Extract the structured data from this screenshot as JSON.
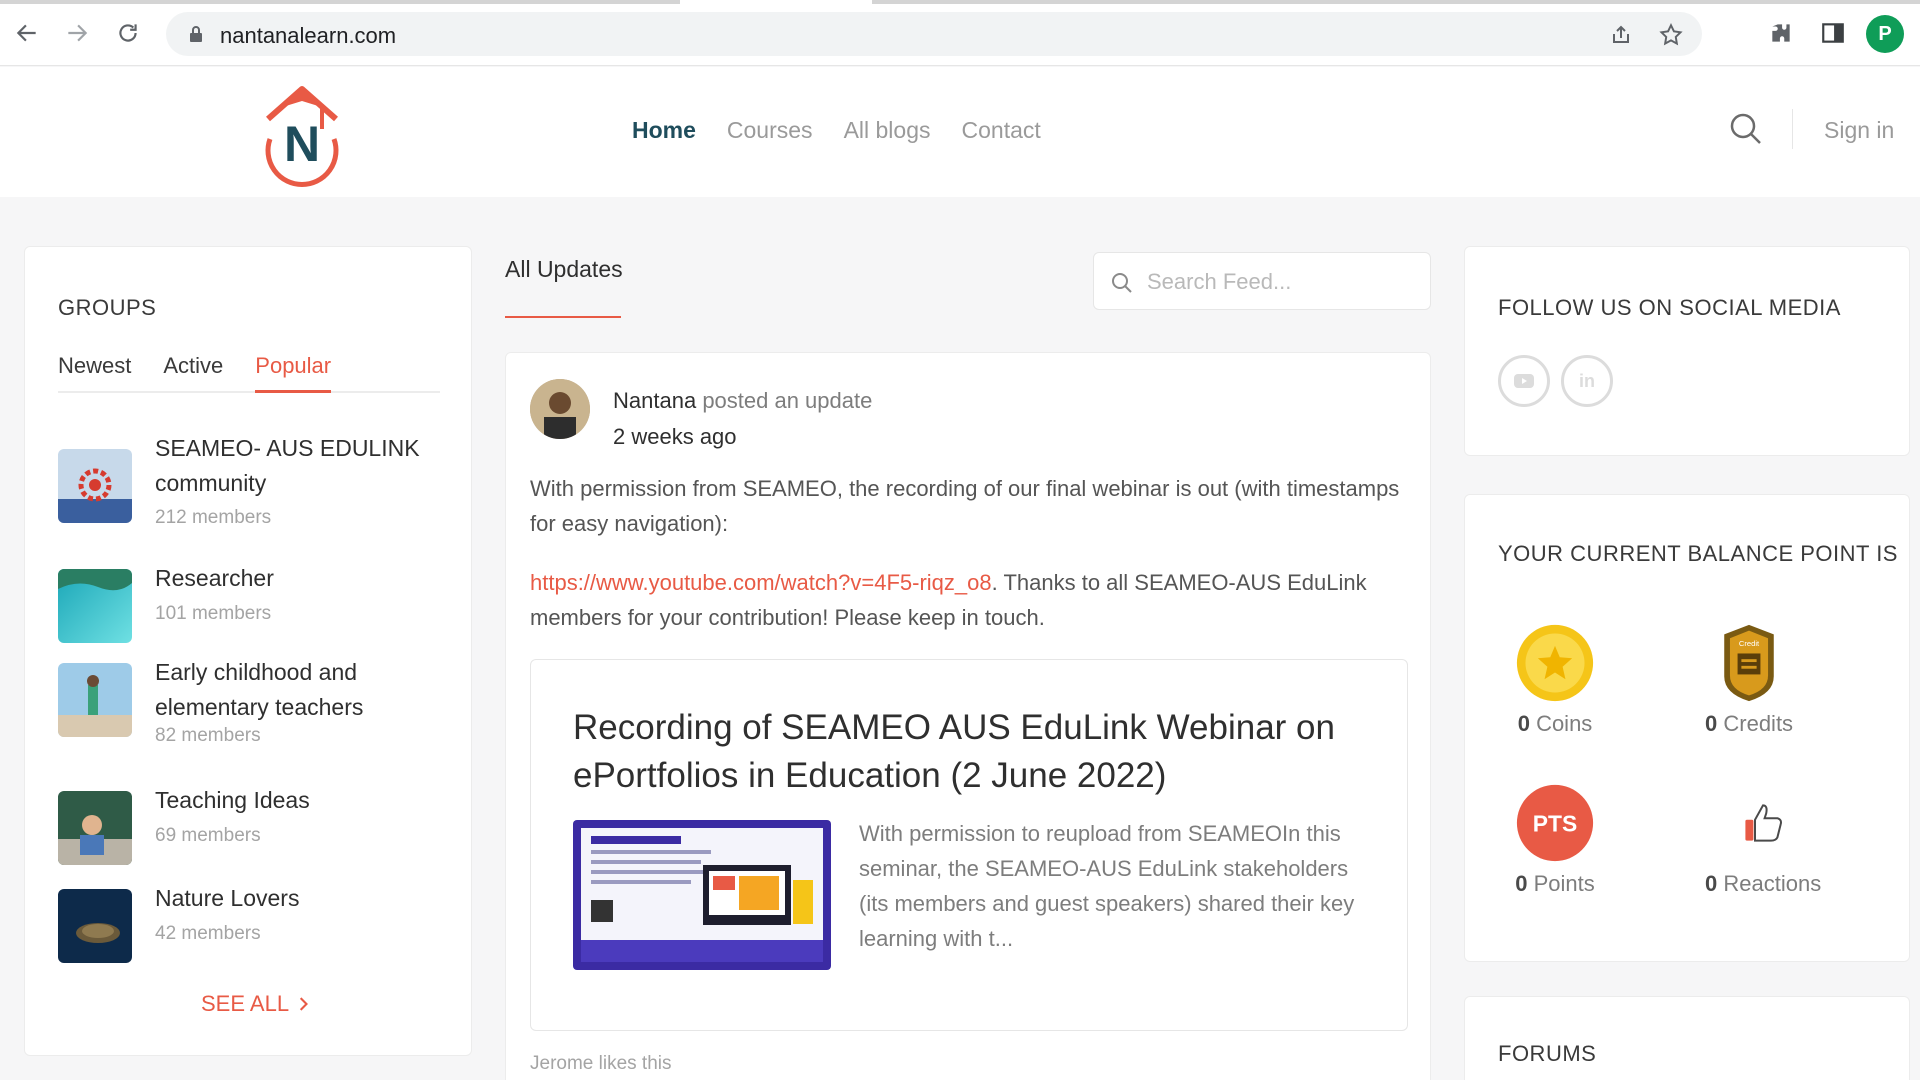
{
  "browser": {
    "url": "nantanalearn.com",
    "profile_initial": "P",
    "icons": [
      "back-arrow-icon",
      "forward-arrow-icon",
      "reload-icon",
      "lock-icon",
      "share-icon",
      "star-icon",
      "extensions-puzzle-icon",
      "side-panel-icon"
    ]
  },
  "header": {
    "logo_letter": "N",
    "nav": [
      "Home",
      "Courses",
      "All blogs",
      "Contact"
    ],
    "active_nav": "Home",
    "sign_in": "Sign in"
  },
  "groups": {
    "title": "GROUPS",
    "tabs": [
      "Newest",
      "Active",
      "Popular"
    ],
    "active_tab": "Popular",
    "items": [
      {
        "name": "SEAMEO- AUS EDULINK community",
        "members": "212 members"
      },
      {
        "name": "Researcher",
        "members": "101 members"
      },
      {
        "name": "Early childhood and elementary teachers",
        "members": "82 members"
      },
      {
        "name": "Teaching Ideas",
        "members": "69 members"
      },
      {
        "name": "Nature Lovers",
        "members": "42 members"
      }
    ],
    "see_all": "SEE ALL"
  },
  "feed": {
    "tab": "All Updates",
    "search_placeholder": "Search Feed...",
    "post": {
      "author": "Nantana",
      "action": "posted an update",
      "time": "2 weeks ago",
      "text1": "With permission from SEAMEO, the recording of our final webinar is out (with timestamps for easy navigation):",
      "link": "https://www.youtube.com/watch?v=4F5-riqz_o8",
      "text2": ". Thanks to all SEAMEO-AUS EduLink members for your contribution! Please keep in touch.",
      "preview_title": "Recording of SEAMEO AUS EduLink Webinar on ePortfolios in Education (2 June 2022)",
      "preview_desc": "With permission to reupload from SEAMEOIn this seminar, the SEAMEO-AUS EduLink stakeholders (its members and guest speakers) shared their key learning with t...",
      "likes": "Jerome likes this"
    }
  },
  "social": {
    "title": "FOLLOW US ON SOCIAL MEDIA",
    "icons": [
      "youtube-icon",
      "linkedin-icon"
    ],
    "linkedin_text": "in"
  },
  "balance": {
    "title": "YOUR CURRENT BALANCE POINT IS",
    "items": [
      {
        "value": "0",
        "label": "Coins"
      },
      {
        "value": "0",
        "label": "Credits"
      },
      {
        "value": "0",
        "label": "Points"
      },
      {
        "value": "0",
        "label": "Reactions"
      }
    ],
    "pts_badge": "PTS",
    "credit_badge": "Credit"
  },
  "forums": {
    "title": "FORUMS"
  },
  "colors": {
    "accent": "#e85a45",
    "nav_active": "#1f4d5c",
    "profile": "#0f9d58",
    "coin": "#f5c518"
  }
}
